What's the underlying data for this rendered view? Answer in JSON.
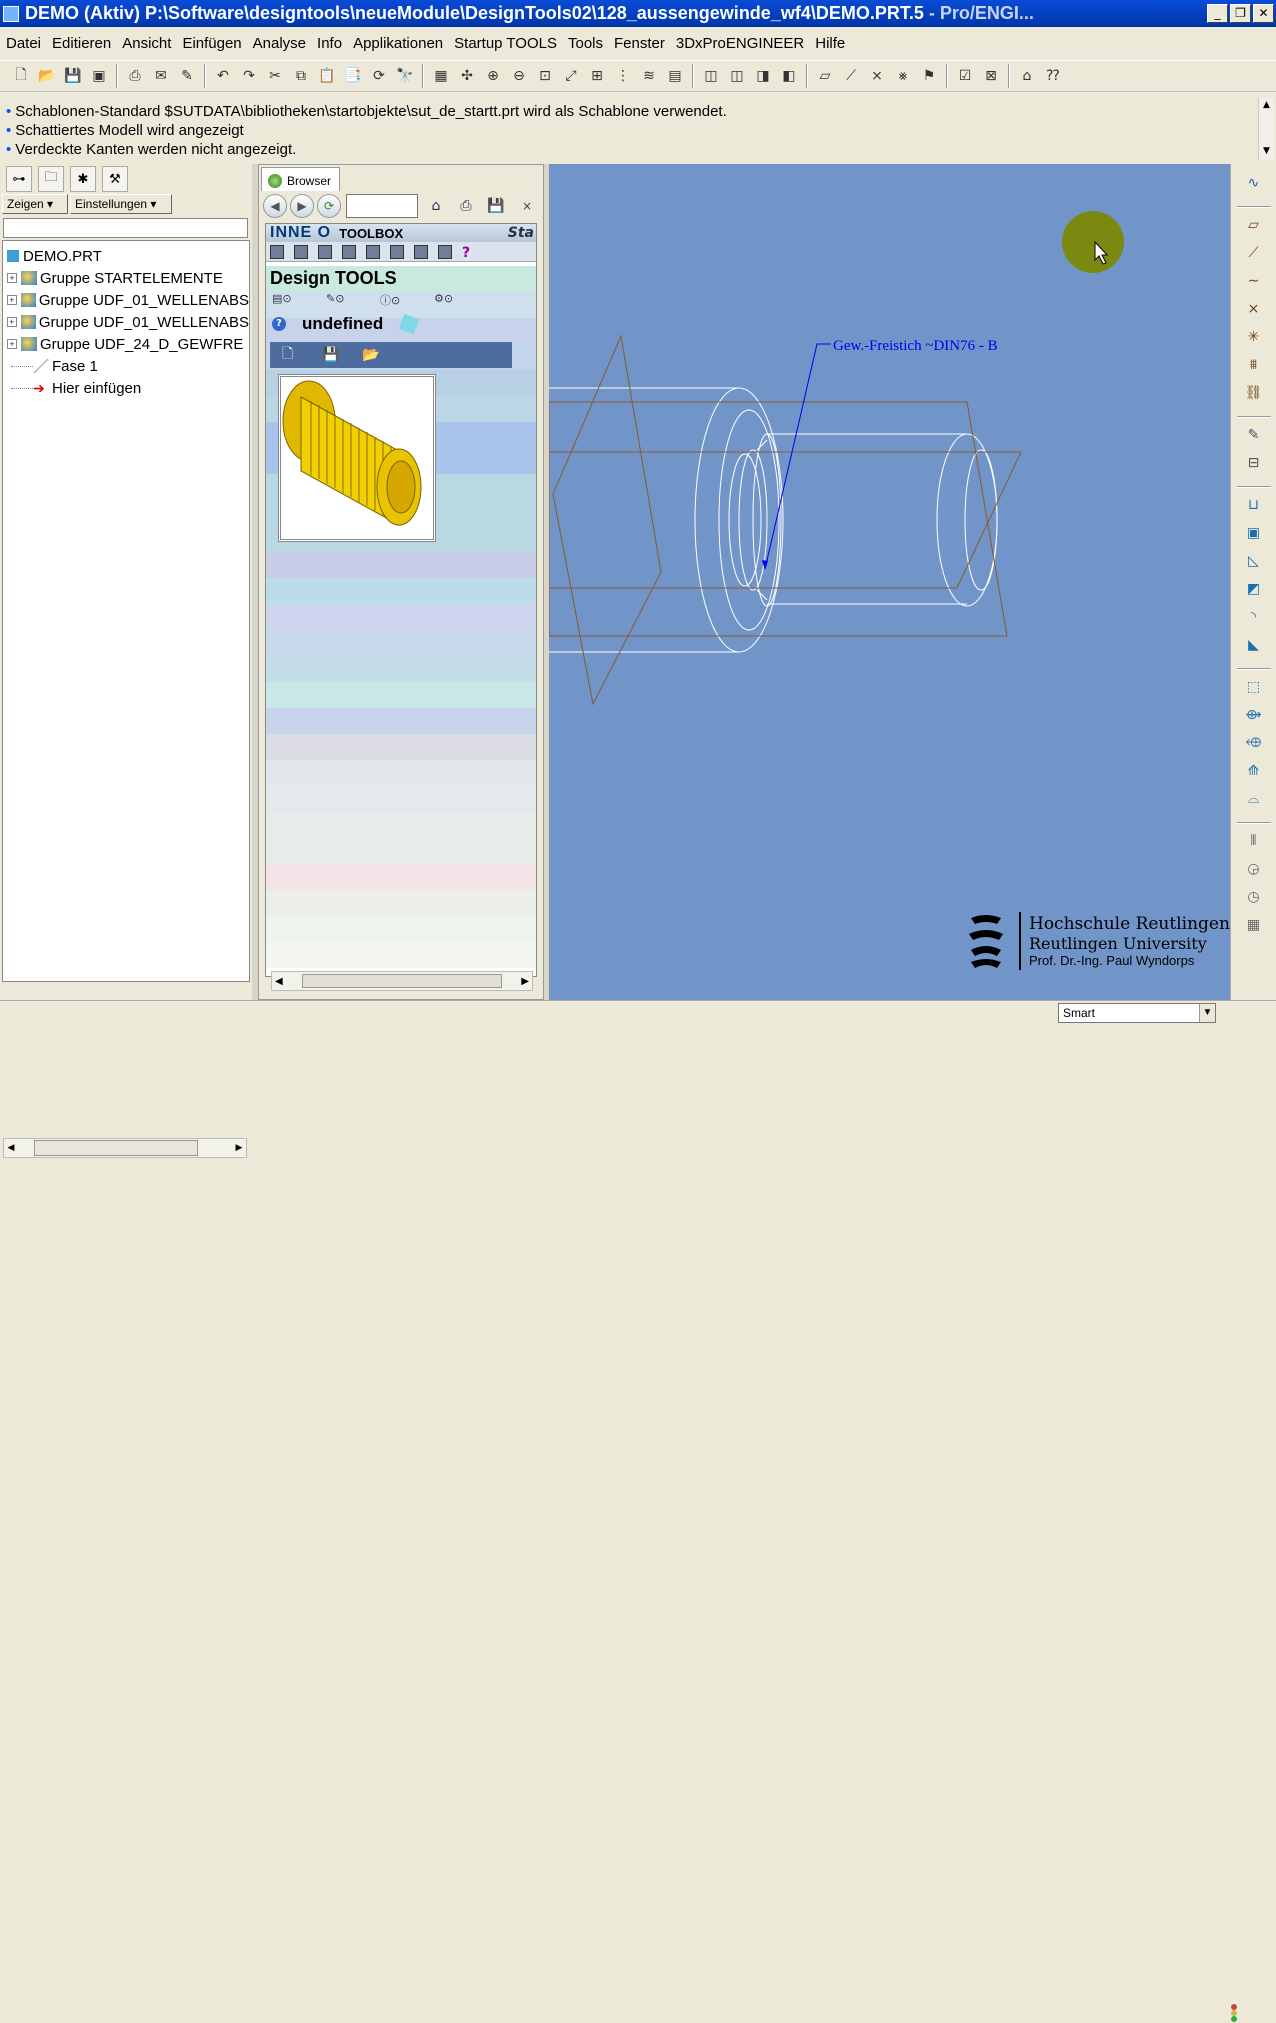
{
  "window": {
    "title_main": "DEMO (Aktiv) P:\\Software\\designtools\\neueModule\\DesignTools02\\128_aussengewinde_wf4\\DEMO.PRT.5",
    "title_suffix": " - Pro/ENGI...",
    "btn_min": "_",
    "btn_max": "❐",
    "btn_close": "✕"
  },
  "menu": [
    "Datei",
    "Editieren",
    "Ansicht",
    "Einfügen",
    "Analyse",
    "Info",
    "Applikationen",
    "Startup TOOLS",
    "Tools",
    "Fenster",
    "3DxProENGINEER",
    "Hilfe"
  ],
  "messages": [
    "Schablonen-Standard $SUTDATA\\bibliotheken\\startobjekte\\sut_de_startt.prt wird als Schablone verwendet.",
    "Schattiertes Modell wird angezeigt",
    "Verdeckte Kanten werden nicht angezeigt."
  ],
  "left_panel": {
    "zeigen": "Zeigen ▾",
    "einstellungen": "Einstellungen ▾",
    "tree": [
      {
        "label": "DEMO.PRT",
        "expand": ""
      },
      {
        "label": "Gruppe STARTELEMENTE",
        "expand": "+"
      },
      {
        "label": "Gruppe UDF_01_WELLENABS",
        "expand": "+"
      },
      {
        "label": "Gruppe UDF_01_WELLENABS",
        "expand": "+"
      },
      {
        "label": "Gruppe UDF_24_D_GEWFRE",
        "expand": "+"
      },
      {
        "label": "Fase 1",
        "expand": ""
      },
      {
        "label": "Hier einfügen",
        "expand": ""
      }
    ]
  },
  "browser": {
    "tab": "Browser",
    "close": "×",
    "inneo_logo": "INNE O",
    "toolbox": "TOOLBOX",
    "sta": "Sta",
    "design_tools": "Design TOOLS",
    "undefined": "undefined",
    "help_glyph": "?",
    "question": "?"
  },
  "viewport": {
    "annotation": "Gew.-Freistich ~DIN76 - B",
    "logo_line1": "Hochschule Reutlingen",
    "logo_line2": "Reutlingen University",
    "logo_line3": "Prof. Dr.-Ing. Paul Wyndorps"
  },
  "status": {
    "selector": "Smart"
  },
  "colors": {
    "viewport_bg": "#7195c9",
    "geometry_line": "#ffffff",
    "datum_plane": "#8a5a2a",
    "annotation": "#0000ee",
    "highlight": "#7a8a10"
  }
}
